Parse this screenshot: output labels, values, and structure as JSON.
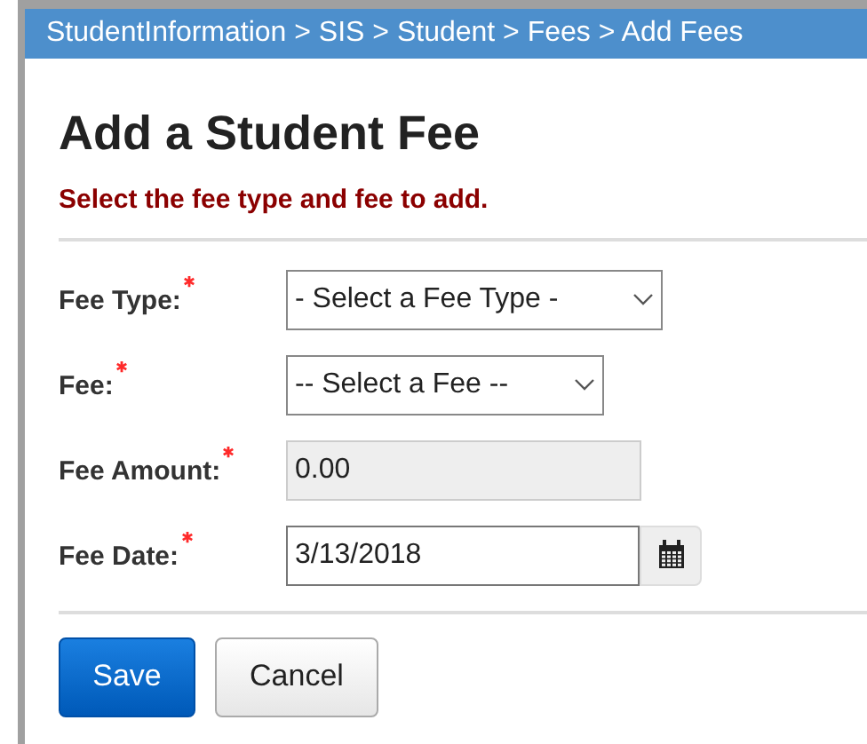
{
  "breadcrumb": "StudentInformation > SIS > Student > Fees > Add Fees",
  "title": "Add a Student Fee",
  "instruction": "Select the fee type and fee to add.",
  "fields": [
    {
      "label": "Fee Type:",
      "required": true,
      "kind": "select",
      "value": "- Select a Fee Type -",
      "disabled": false
    },
    {
      "label": "Fee:",
      "required": true,
      "kind": "select",
      "value": "-- Select a Fee --",
      "disabled": false
    },
    {
      "label": "Fee Amount:",
      "required": true,
      "kind": "text",
      "value": "0.00",
      "disabled": true
    },
    {
      "label": "Fee Date:",
      "required": true,
      "kind": "date",
      "value": "3/13/2018",
      "disabled": false
    }
  ],
  "buttons": [
    {
      "label": "Save",
      "primary": true
    },
    {
      "label": "Cancel",
      "primary": false
    }
  ]
}
